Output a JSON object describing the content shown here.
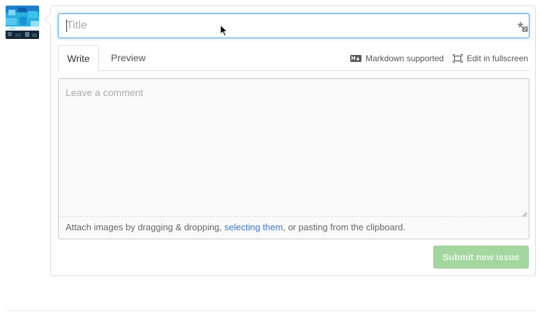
{
  "issue_form": {
    "title_value": "",
    "title_placeholder": "Title",
    "tabs": [
      {
        "label": "Write",
        "selected": true
      },
      {
        "label": "Preview",
        "selected": false
      }
    ],
    "markdown_label": "Markdown supported",
    "fullscreen_label": "Edit in fullscreen",
    "comment_placeholder": "Leave a comment",
    "attach_prefix": "Attach images by dragging & dropping, ",
    "attach_link": "selecting them",
    "attach_suffix": ", or pasting from the clipboard.",
    "submit_label": "Submit new issue"
  },
  "icons": {
    "avatar": "avatar-image",
    "title_assist": "title-assist-icon",
    "markdown": "markdown-icon",
    "fullscreen": "fullscreen-icon",
    "resize": "resize-handle-icon",
    "cursor": "mouse-pointer-icon"
  },
  "colors": {
    "focus_border": "#51a7e8",
    "link": "#4078c0",
    "submit_disabled_bg": "#a3d79f",
    "submit_disabled_text": "#eaf6e8"
  }
}
